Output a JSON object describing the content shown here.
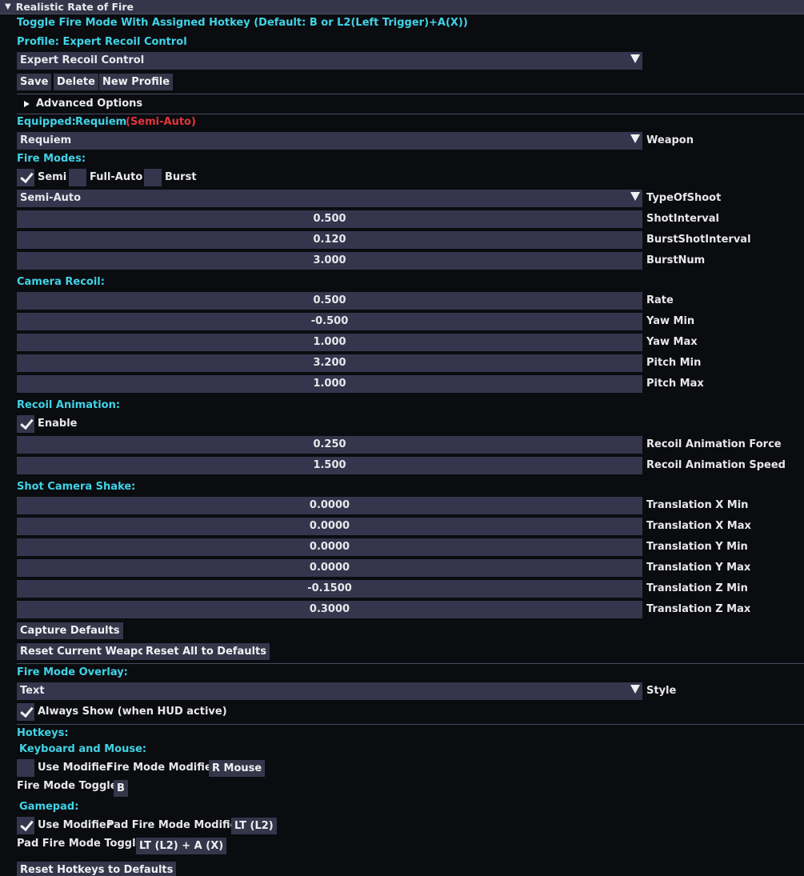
{
  "header": {
    "title": "Realistic Rate of Fire"
  },
  "top_note": "Toggle Fire Mode With Assigned Hotkey (Default: B or L2(Left Trigger)+A(X))",
  "profile": {
    "label": "Profile: Expert Recoil Control",
    "selected": "Expert Recoil Control",
    "save": "Save",
    "delete": "Delete",
    "new_profile": "New Profile",
    "advanced": "Advanced Options"
  },
  "equipped": {
    "label": "Equipped:",
    "weapon": "Requiem",
    "mode": "(Semi-Auto)",
    "dropdown_value": "Requiem",
    "dropdown_label": "Weapon"
  },
  "fire_modes": {
    "heading": "Fire Modes:",
    "semi": {
      "label": "Semi",
      "checked": true
    },
    "full_auto": {
      "label": "Full-Auto",
      "checked": false
    },
    "burst": {
      "label": "Burst",
      "checked": false
    },
    "type_value": "Semi-Auto",
    "type_label": "TypeOfShoot",
    "fields": [
      {
        "value": "0.500",
        "label": "ShotInterval"
      },
      {
        "value": "0.120",
        "label": "BurstShotInterval"
      },
      {
        "value": "3.000",
        "label": "BurstNum"
      }
    ]
  },
  "camera_recoil": {
    "heading": "Camera Recoil:",
    "fields": [
      {
        "value": "0.500",
        "label": "Rate"
      },
      {
        "value": "-0.500",
        "label": "Yaw Min"
      },
      {
        "value": "1.000",
        "label": "Yaw Max"
      },
      {
        "value": "3.200",
        "label": "Pitch Min"
      },
      {
        "value": "1.000",
        "label": "Pitch Max"
      }
    ]
  },
  "recoil_animation": {
    "heading": "Recoil Animation:",
    "enable": {
      "label": "Enable",
      "checked": true
    },
    "fields": [
      {
        "value": "0.250",
        "label": "Recoil Animation Force"
      },
      {
        "value": "1.500",
        "label": "Recoil Animation Speed"
      }
    ]
  },
  "shot_camera_shake": {
    "heading": "Shot Camera Shake:",
    "fields": [
      {
        "value": "0.0000",
        "label": "Translation X Min"
      },
      {
        "value": "0.0000",
        "label": "Translation X Max"
      },
      {
        "value": "0.0000",
        "label": "Translation Y Min"
      },
      {
        "value": "0.0000",
        "label": "Translation Y Max"
      },
      {
        "value": "-0.1500",
        "label": "Translation Z Min"
      },
      {
        "value": "0.3000",
        "label": "Translation Z Max"
      }
    ]
  },
  "buttons": {
    "capture_defaults": "Capture Defaults",
    "reset_current": "Reset Current Weapon",
    "reset_all": "Reset All to Defaults"
  },
  "overlay": {
    "heading": "Fire Mode Overlay:",
    "style_value": "Text",
    "style_label": "Style",
    "always_show": {
      "label": "Always Show (when HUD active)",
      "checked": true
    }
  },
  "hotkeys": {
    "heading": "Hotkeys:",
    "kbm_heading": "Keyboard and Mouse:",
    "kbm_use_modifier": {
      "label": "Use Modifier",
      "checked": false
    },
    "kbm_modifier_label": "Fire Mode Modifier:",
    "kbm_modifier_value": "R Mouse",
    "kbm_toggle_label": "Fire Mode Toggle:",
    "kbm_toggle_value": "B",
    "pad_heading": "Gamepad:",
    "pad_use_modifier": {
      "label": "Use Modifier",
      "checked": true
    },
    "pad_modifier_label": "Pad Fire Mode Modifier:",
    "pad_modifier_value": "LT (L2)",
    "pad_toggle_label": "Pad Fire Mode Toggle:",
    "pad_toggle_value": "LT (L2) + A (X)",
    "reset_hotkeys": "Reset Hotkeys to Defaults"
  },
  "colors": {
    "accent": "#3fd3e6",
    "warning": "#e2343b",
    "field_bg": "#35364d",
    "background": "#0b0c10"
  }
}
